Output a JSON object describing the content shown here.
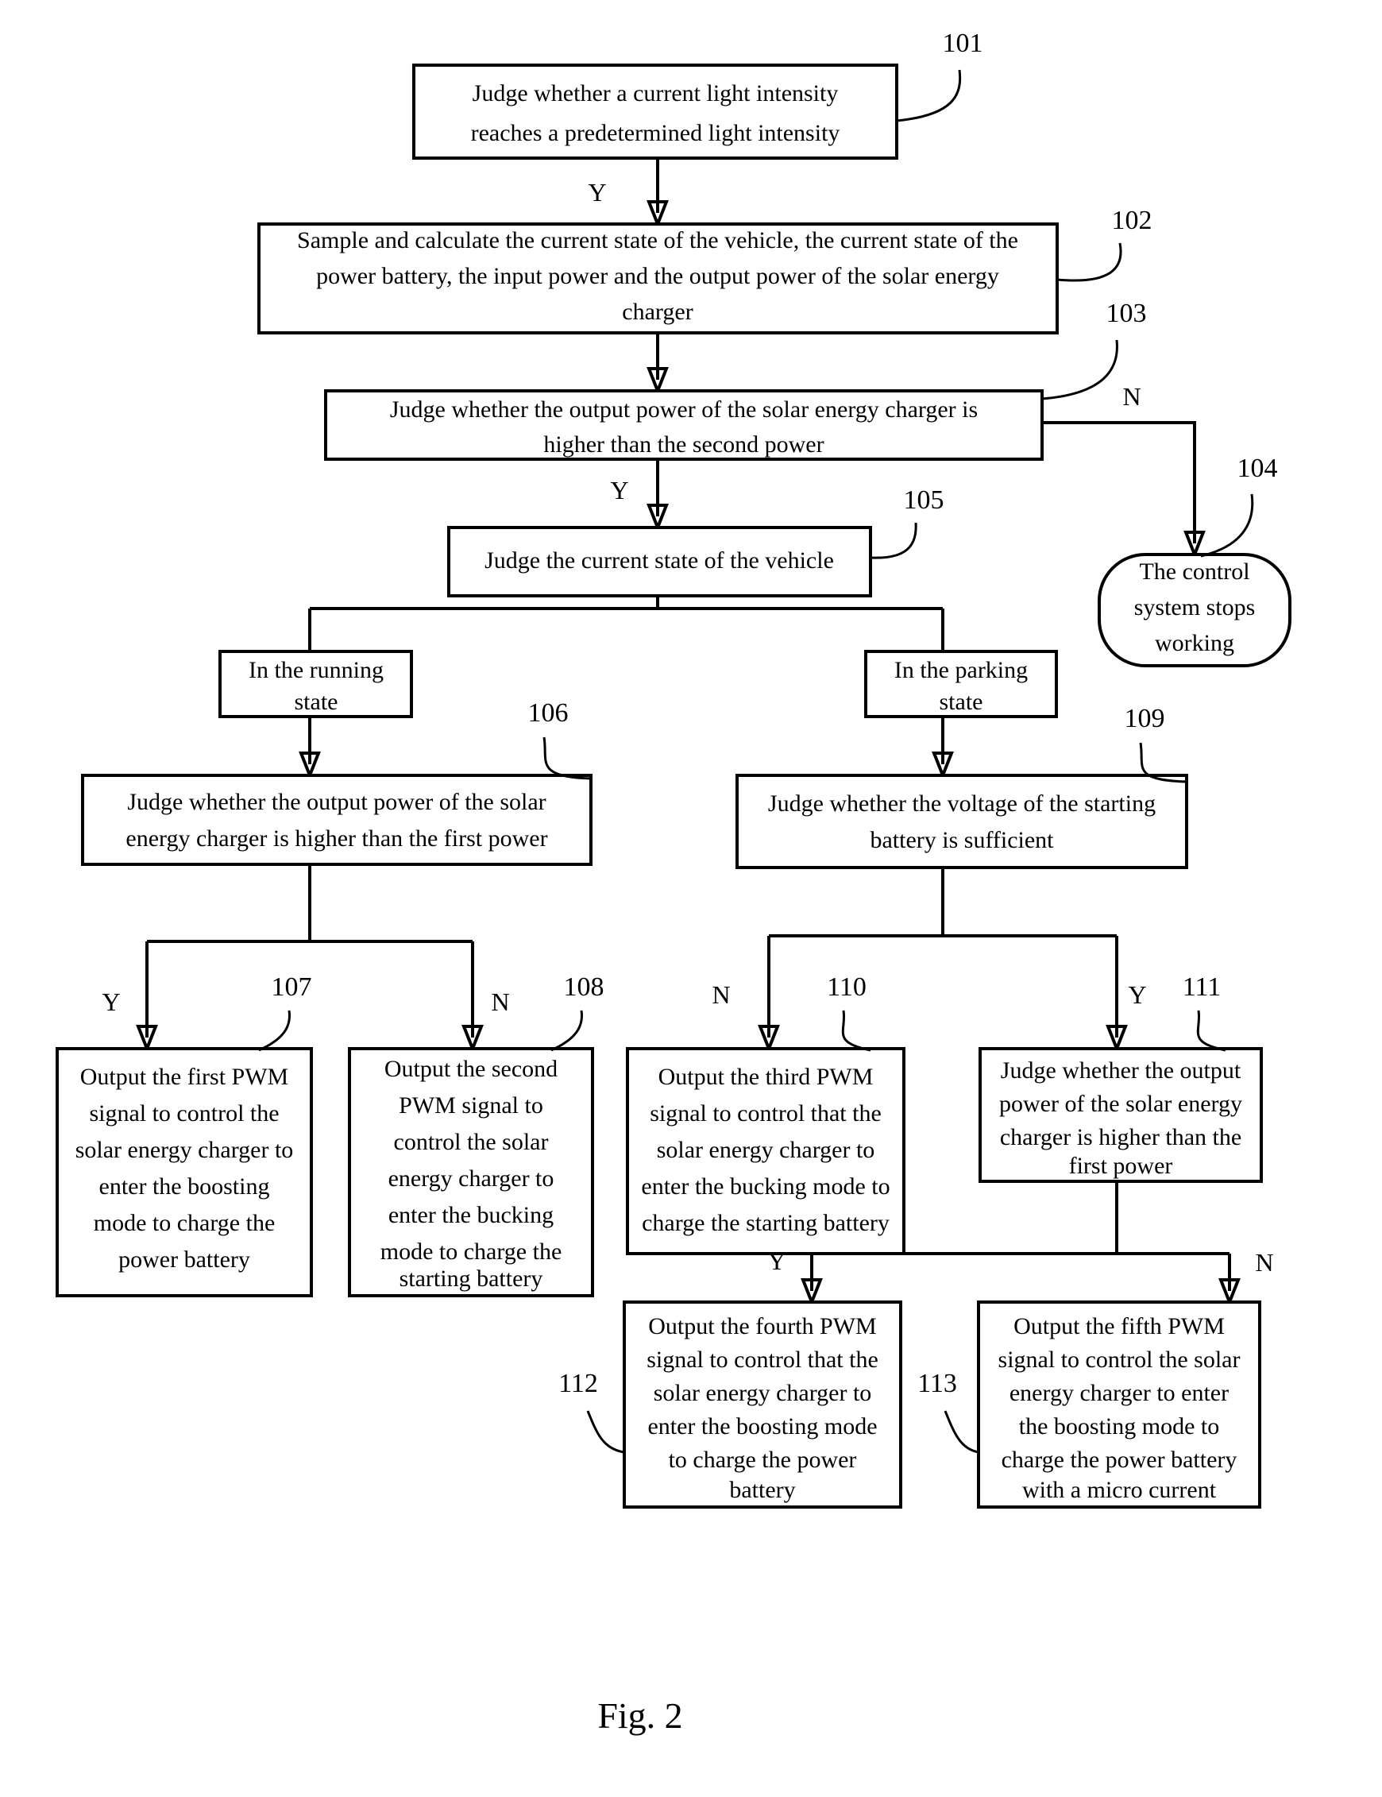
{
  "figure": {
    "caption": "Fig. 2"
  },
  "nodes": [
    {
      "id": "101",
      "ref": "101",
      "shape": "rect",
      "lines": [
        "Judge whether a current light intensity",
        "reaches a predetermined light intensity"
      ]
    },
    {
      "id": "102",
      "ref": "102",
      "shape": "rect",
      "lines": [
        "Sample and calculate the current state of the vehicle, the current state of the",
        "power battery, the input power and the output power of the solar energy",
        "charger"
      ]
    },
    {
      "id": "103",
      "ref": "103",
      "shape": "rect",
      "lines": [
        "Judge whether the output power of the solar energy charger is",
        "higher than the second power"
      ]
    },
    {
      "id": "104",
      "ref": "104",
      "shape": "stadium",
      "lines": [
        "The control",
        "system stops",
        "working"
      ]
    },
    {
      "id": "105",
      "ref": "105",
      "shape": "rect",
      "lines": [
        "Judge the current state of the vehicle"
      ]
    },
    {
      "id": "running",
      "ref": "",
      "shape": "rect",
      "lines": [
        "In the running",
        "state"
      ]
    },
    {
      "id": "parking",
      "ref": "",
      "shape": "rect",
      "lines": [
        "In the parking",
        "state"
      ]
    },
    {
      "id": "106",
      "ref": "106",
      "shape": "rect",
      "lines": [
        "Judge whether the output power of the solar",
        "energy charger is higher than the first power"
      ]
    },
    {
      "id": "107",
      "ref": "107",
      "shape": "rect",
      "lines": [
        "Output the first PWM",
        "signal to control the",
        "solar energy charger to",
        "enter the boosting",
        "mode to charge the",
        "power battery"
      ]
    },
    {
      "id": "108",
      "ref": "108",
      "shape": "rect",
      "lines": [
        "Output the second",
        "PWM signal to",
        "control the solar",
        "energy charger to",
        "enter the bucking",
        "mode to charge the",
        "starting battery"
      ]
    },
    {
      "id": "109",
      "ref": "109",
      "shape": "rect",
      "lines": [
        "Judge whether the voltage of the starting",
        "battery is sufficient"
      ]
    },
    {
      "id": "110",
      "ref": "110",
      "shape": "rect",
      "lines": [
        "Output the third PWM",
        "signal to control that the",
        "solar energy charger to",
        "enter the bucking mode to",
        "charge the starting battery"
      ]
    },
    {
      "id": "111",
      "ref": "111",
      "shape": "rect",
      "lines": [
        "Judge whether the output",
        "power of the solar energy",
        "charger is higher than the",
        "first power"
      ]
    },
    {
      "id": "112",
      "ref": "112",
      "shape": "rect",
      "lines": [
        "Output the fourth PWM",
        "signal to control that the",
        "solar energy charger to",
        "enter the boosting mode",
        "to charge the power",
        "battery"
      ]
    },
    {
      "id": "113",
      "ref": "113",
      "shape": "rect",
      "lines": [
        "Output the fifth PWM",
        "signal to control the solar",
        "energy charger to enter",
        "the boosting mode to",
        "charge the power battery",
        "with a micro current"
      ]
    }
  ],
  "branch_labels": {
    "b101_102": "Y",
    "b103_no": "N",
    "b103_yes": "Y",
    "b106_yes": "Y",
    "b106_no": "N",
    "b109_no": "N",
    "b109_yes": "Y",
    "b111_yes": "Y",
    "b111_no": "N"
  },
  "colors": {
    "stroke": "#000000",
    "fill": "#ffffff",
    "text": "#000000"
  }
}
